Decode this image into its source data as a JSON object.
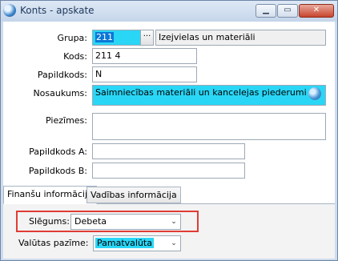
{
  "window": {
    "title": "Konts - apskate",
    "min_icon": "minimize-icon",
    "max_icon": "maximize-icon",
    "close_icon": "close-icon"
  },
  "form": {
    "grupa_label": "Grupa:",
    "grupa_code": "211",
    "grupa_browse": "···",
    "grupa_name": "Izejvielas un materiāli",
    "kods_label": "Kods:",
    "kods_value": "211 4",
    "papildkods_label": "Papildkods:",
    "papildkods_value": "N",
    "nosaukums_label": "Nosaukums:",
    "nosaukums_value": "Saimniecības materiāli un kancelejas piederumi",
    "piezimes_label": "Piezīmes:",
    "piezimes_value": "",
    "papildkods_a_label": "Papildkods A:",
    "papildkods_a_value": "",
    "papildkods_b_label": "Papildkods B:",
    "papildkods_b_value": ""
  },
  "tabs": [
    {
      "label": "Finanšu informācija",
      "active": true
    },
    {
      "label": "Vadības informācija",
      "active": false
    }
  ],
  "finance": {
    "slegums_label": "Slēgums:",
    "slegums_value": "Debeta",
    "valutas_label": "Valūtas pazīme:",
    "valutas_value": "Pamatvalūta"
  },
  "colors": {
    "selected_field": "#2ad6f6",
    "highlight_box": "#e03c35",
    "window_frame": "#cfdcec"
  }
}
